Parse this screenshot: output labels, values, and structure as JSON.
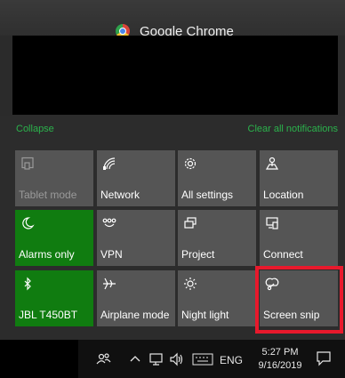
{
  "app_header": {
    "title": "Google Chrome"
  },
  "action_center": {
    "collapse_label": "Collapse",
    "clear_label": "Clear all notifications",
    "accent_color": "#2bb24c",
    "tiles": [
      {
        "label": "Tablet mode",
        "icon": "tablet-mode-icon",
        "state": "disabled"
      },
      {
        "label": "Network",
        "icon": "network-icon",
        "state": "off"
      },
      {
        "label": "All settings",
        "icon": "gear-icon",
        "state": "off"
      },
      {
        "label": "Location",
        "icon": "location-icon",
        "state": "off"
      },
      {
        "label": "Alarms only",
        "icon": "moon-icon",
        "state": "on"
      },
      {
        "label": "VPN",
        "icon": "vpn-icon",
        "state": "off"
      },
      {
        "label": "Project",
        "icon": "project-icon",
        "state": "off"
      },
      {
        "label": "Connect",
        "icon": "connect-icon",
        "state": "off"
      },
      {
        "label": "JBL T450BT",
        "icon": "bluetooth-icon",
        "state": "on"
      },
      {
        "label": "Airplane mode",
        "icon": "airplane-icon",
        "state": "off"
      },
      {
        "label": "Night light",
        "icon": "night-light-icon",
        "state": "off"
      },
      {
        "label": "Screen snip",
        "icon": "screen-snip-icon",
        "state": "off"
      }
    ],
    "on_color": "#107c10",
    "highlight_color": "#e8192c"
  },
  "taskbar": {
    "language": "ENG",
    "time": "5:27 PM",
    "date": "9/16/2019"
  }
}
